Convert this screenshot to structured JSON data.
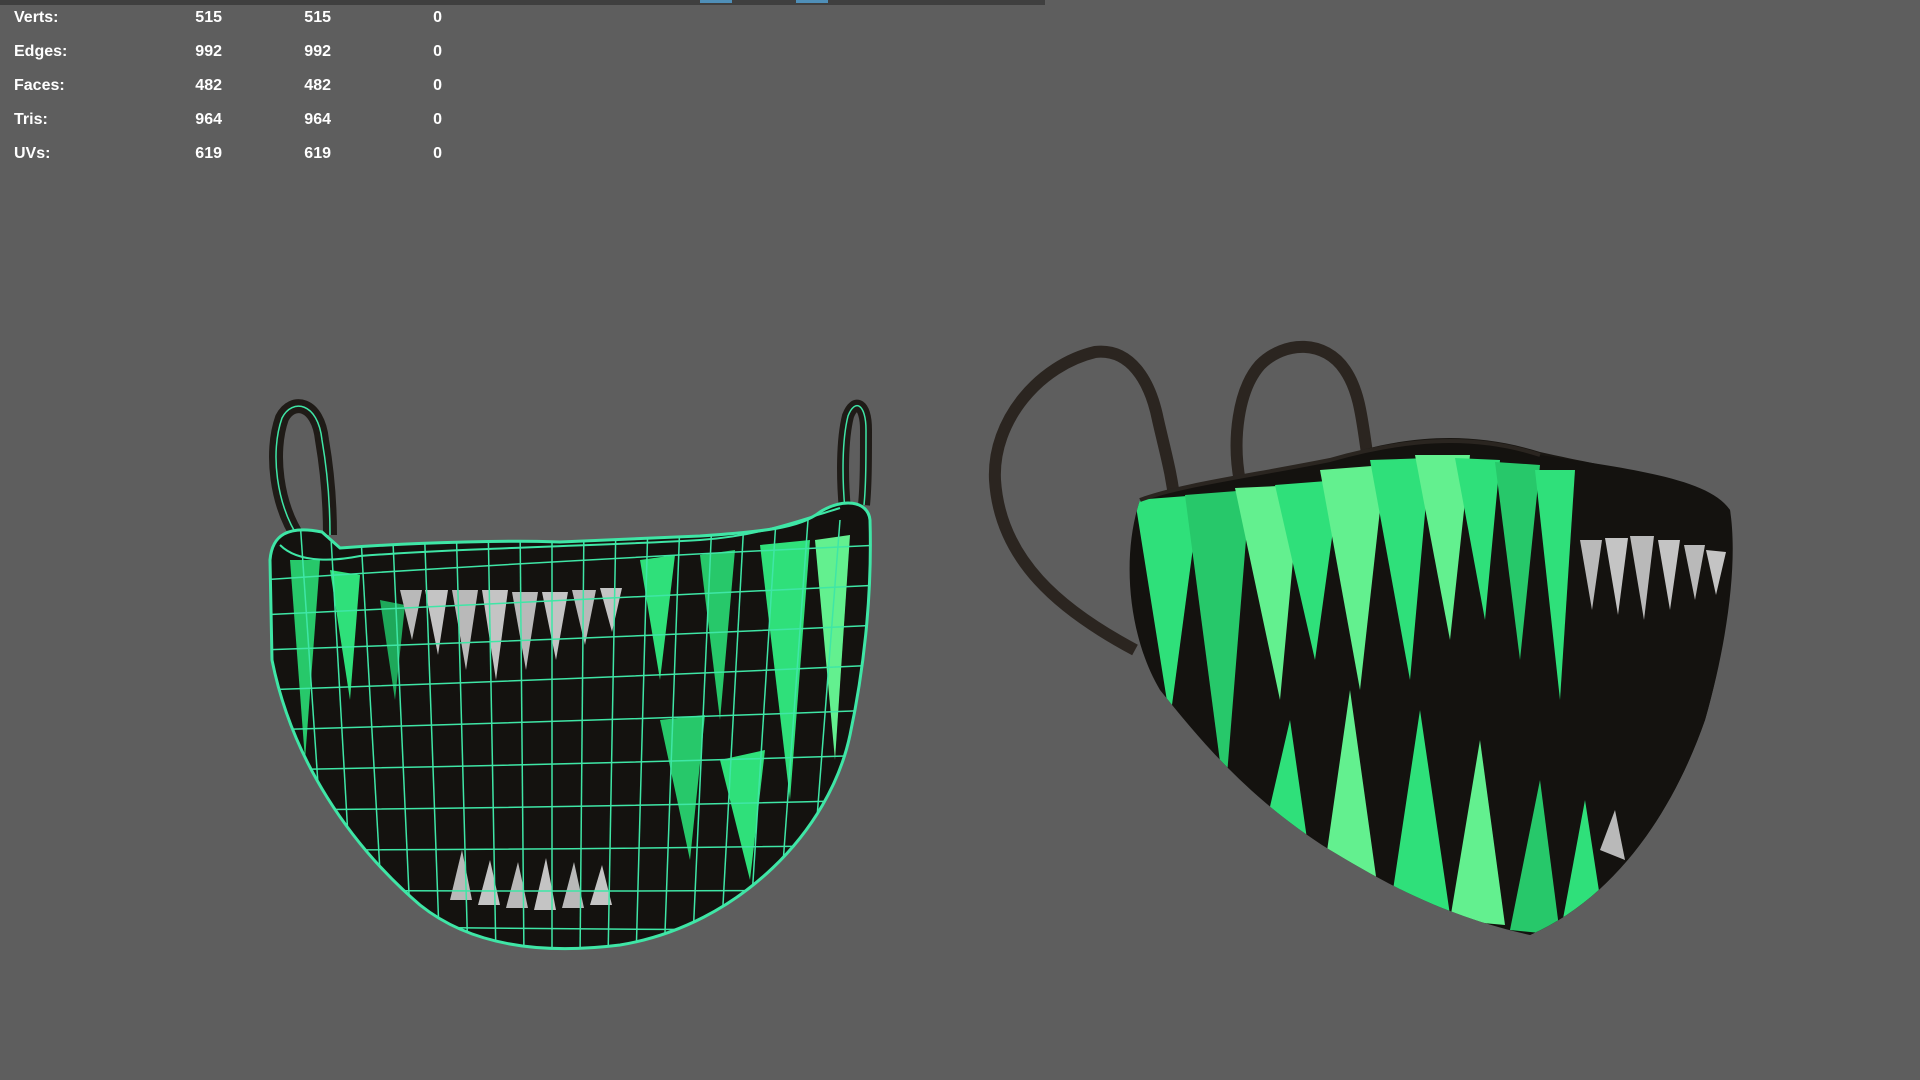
{
  "stats": {
    "rows": [
      {
        "label": "Verts:",
        "values": [
          "515",
          "515",
          "0"
        ]
      },
      {
        "label": "Edges:",
        "values": [
          "992",
          "992",
          "0"
        ]
      },
      {
        "label": "Faces:",
        "values": [
          "482",
          "482",
          "0"
        ]
      },
      {
        "label": "Tris:",
        "values": [
          "964",
          "964",
          "0"
        ]
      },
      {
        "label": "UVs:",
        "values": [
          "619",
          "619",
          "0"
        ]
      }
    ]
  },
  "colors": {
    "viewport_bg": "#5e5e5e",
    "wireframe": "#3fe6a6",
    "mask_base": "#14120f",
    "strap": "#2b2520",
    "fang_green": "#2fe07a",
    "fang_green_light": "#63f08f",
    "fang_white": "#b9b9b9"
  }
}
